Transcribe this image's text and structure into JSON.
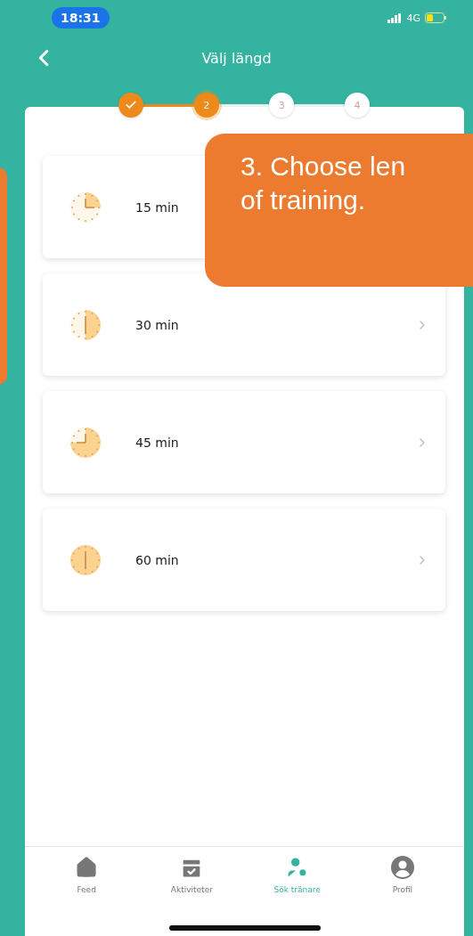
{
  "status_bar": {
    "time": "18:31",
    "network": "4G"
  },
  "header": {
    "title": "Välj längd"
  },
  "stepper": [
    {
      "completed": true,
      "selected": false
    },
    {
      "label": "2",
      "completed": false,
      "selected": true
    },
    {
      "label": "3",
      "completed": false,
      "selected": false
    },
    {
      "label": "4",
      "completed": false,
      "selected": false
    }
  ],
  "durations": [
    {
      "label": "15 min",
      "kind": "quarter"
    },
    {
      "label": "30 min",
      "kind": "half"
    },
    {
      "label": "45 min",
      "kind": "threequarter"
    },
    {
      "label": "60 min",
      "kind": "full"
    }
  ],
  "tab_bar": [
    {
      "label": "Feed",
      "selected": false
    },
    {
      "label": "Aktiviteter",
      "selected": false
    },
    {
      "label": "Sök tränare",
      "selected": true
    },
    {
      "label": "Profil",
      "selected": false
    }
  ],
  "callout": {
    "text": "3. Choose len\nof training."
  }
}
